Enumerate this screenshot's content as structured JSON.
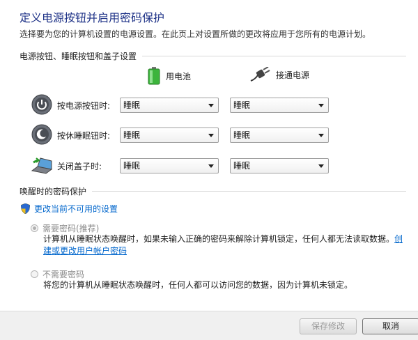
{
  "page": {
    "title": "定义电源按钮并启用密码保护",
    "subtitle": "选择要为您的计算机设置的电源设置。在此页上对设置所做的更改将应用于您所有的电源计划。"
  },
  "power_section": {
    "heading": "电源按钮、睡眠按钮和盖子设置",
    "col_battery": "用电池",
    "col_plugged": "接通电源",
    "rows": [
      {
        "label": "按电源按钮时:",
        "battery": "睡眠",
        "plugged": "睡眠",
        "icon": "power-button-icon"
      },
      {
        "label": "按休睡眠钮时:",
        "battery": "睡眠",
        "plugged": "睡眠",
        "icon": "sleep-button-icon"
      },
      {
        "label": "关闭盖子时:",
        "battery": "睡眠",
        "plugged": "睡眠",
        "icon": "laptop-lid-icon"
      }
    ]
  },
  "password_section": {
    "heading": "唤醒时的密码保护",
    "change_link": "更改当前不可用的设置",
    "opt_require": "需要密码(推荐)",
    "opt_require_desc": "计算机从睡眠状态唤醒时，如果未输入正确的密码来解除计算机锁定，任何人都无法读取数据。",
    "opt_require_link1": "创",
    "opt_require_link2": "建或更改用户帐户密码",
    "opt_none": "不需要密码",
    "opt_none_desc": "将您的计算机从睡眠状态唤醒时，任何人都可以访问您的数据，因为计算机未锁定。"
  },
  "footer": {
    "save": "保存修改",
    "cancel": "取消"
  },
  "colors": {
    "title": "#1e3287",
    "link": "#0066cc",
    "battery_green": "#3cb43c"
  }
}
